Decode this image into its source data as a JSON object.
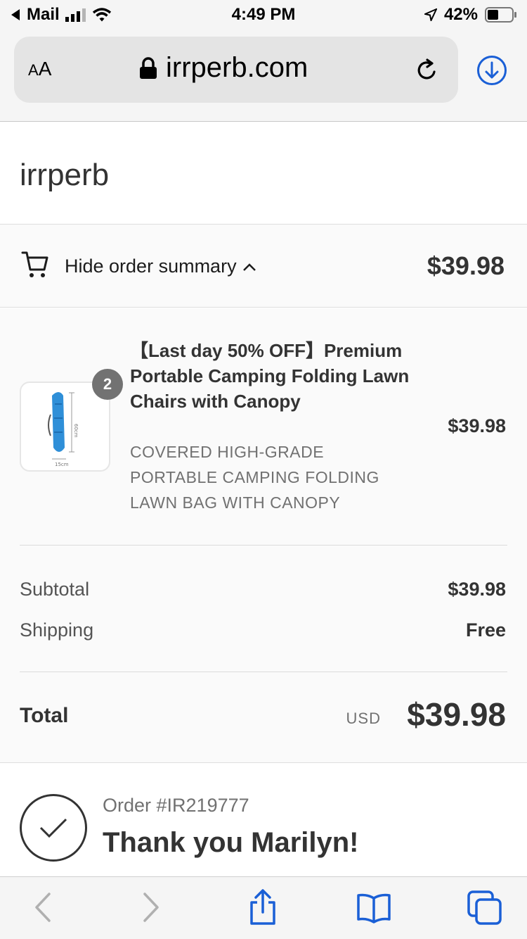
{
  "status_bar": {
    "back_app": "Mail",
    "time": "4:49 PM",
    "battery": "42%"
  },
  "browser": {
    "text_size_label_small": "A",
    "text_size_label_large": "A",
    "domain": "irrperb.com"
  },
  "store": {
    "name": "irrperb"
  },
  "summary_toggle": {
    "label": "Hide order summary",
    "total": "$39.98"
  },
  "line_item": {
    "quantity": "2",
    "title": "【Last day 50% OFF】Premium Portable Camping Folding Lawn Chairs with Canopy",
    "variant": "COVERED HIGH-GRADE PORTABLE CAMPING FOLDING LAWN BAG WITH CANOPY",
    "price": "$39.98",
    "image_dimension_vertical": "60cm",
    "image_dimension_horizontal": "15cm"
  },
  "totals": {
    "subtotal_label": "Subtotal",
    "subtotal_value": "$39.98",
    "shipping_label": "Shipping",
    "shipping_value": "Free",
    "total_label": "Total",
    "currency": "USD",
    "total_value": "$39.98"
  },
  "confirmation": {
    "order_number": "Order #IR219777",
    "message": "Thank you Marilyn!"
  },
  "colors": {
    "accent_blue": "#1a5fd6",
    "product_blue": "#2f8fd8"
  }
}
